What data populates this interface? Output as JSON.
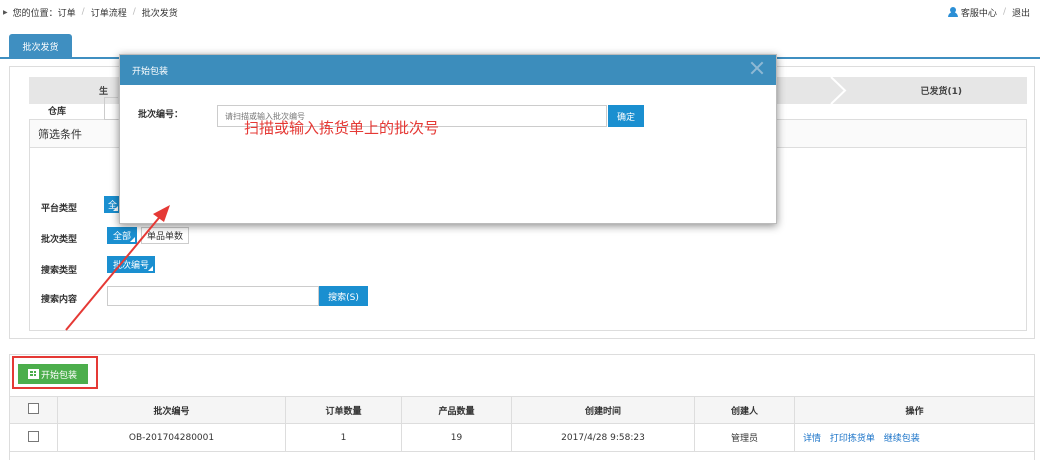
{
  "breadcrumb": {
    "prefix": "您的位置：",
    "items": [
      "订单",
      "订单流程",
      "批次发货"
    ],
    "separator": "/"
  },
  "top_links": {
    "service": "客服中心",
    "separator": "/",
    "logout": "退出"
  },
  "tabs": [
    {
      "label": "批次发货",
      "active": true
    }
  ],
  "steps": {
    "first_fragment": "生",
    "shipped": "已发货(1)"
  },
  "filter": {
    "title": "筛选条件",
    "warehouse_label": "仓库",
    "platform_label": "平台类型",
    "platform_chip": "全",
    "batch_type_label": "批次类型",
    "batch_type_options": [
      "全部",
      "单品单数"
    ],
    "search_type_label": "搜索类型",
    "search_type_option": "批次编号",
    "search_content_label": "搜索内容",
    "search_button": "搜索(S)"
  },
  "list": {
    "start_button": "开始包装",
    "columns": [
      "批次编号",
      "订单数量",
      "产品数量",
      "创建时间",
      "创建人",
      "操作"
    ],
    "rows": [
      {
        "batch_no": "OB-201704280001",
        "orders": "1",
        "products": "19",
        "created": "2017/4/28 9:58:23",
        "creator": "管理员",
        "actions": [
          "详情",
          "打印拣货单",
          "继续包装"
        ]
      }
    ]
  },
  "modal": {
    "title": "开始包装",
    "label": "批次编号：",
    "placeholder": "请扫描或输入批次编号",
    "confirm": "确定"
  },
  "annotation": "扫描或输入拣货单上的批次号",
  "colors": {
    "primary": "#3c8dbc",
    "button_blue": "#1a8fd0",
    "button_green": "#4cae4c",
    "annotation_red": "#e53935"
  }
}
